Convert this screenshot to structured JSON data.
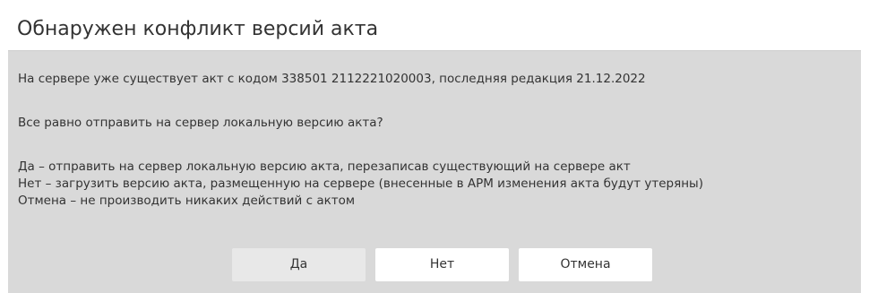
{
  "dialog": {
    "title": "Обнаружен конфликт версий акта",
    "message_line1": "На сервере уже существует акт с кодом 338501 2112221020003, последняя редакция 21.12.2022",
    "question": "Все равно отправить на сервер локальную версию акта?",
    "option_yes": "Да – отправить на сервер локальную версию акта, перезаписав существующий на сервере акт",
    "option_no": "Нет – загрузить версию акта, размещенную на сервере (внесенные в АРМ изменения акта будут утеряны)",
    "option_cancel": "Отмена – не производить никаких действий с актом"
  },
  "buttons": {
    "yes_label": "Да",
    "no_label": "Нет",
    "cancel_label": "Отмена"
  },
  "colors": {
    "dialog_background": "#d9d9d9",
    "title_background": "#ffffff",
    "text": "#333333",
    "button_default": "#e8e8e8",
    "button": "#ffffff"
  }
}
